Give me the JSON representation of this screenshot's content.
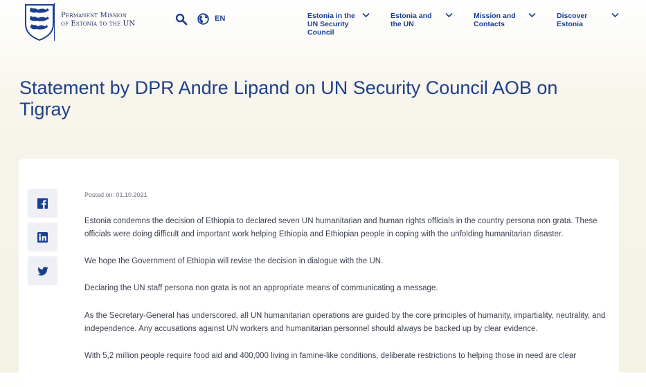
{
  "header": {
    "brand_line1": "Permanent Mission",
    "brand_line2": "of Estonia to the UN",
    "lang_label": "EN",
    "logo_icon": "estonian-coat-of-arms-icon",
    "search_icon": "search-icon",
    "globe_icon": "globe-icon",
    "nav": [
      {
        "label": "Estonia in the UN Security Council"
      },
      {
        "label": "Estonia and the UN"
      },
      {
        "label": "Mission and Contacts"
      },
      {
        "label": "Discover Estonia"
      }
    ]
  },
  "page": {
    "title": "Statement by DPR Andre Lipand on UN Security Council AOB on Tigray",
    "posted_on": "Posted on: 01.10.2021",
    "paragraphs": [
      "Estonia condemns the decision of Ethiopia to declared seven UN humanitarian and human rights officials in the country persona non grata. These officials were doing difficult and important work helping Ethiopia and Ethiopian people in coping with the unfolding humanitarian disaster.",
      "We hope the Government of Ethiopia will revise the decision in dialogue with the UN.",
      "Declaring the UN staff persona non grata is not an appropriate means of communicating a message.",
      "As the Secretary-General has underscored, all UN humanitarian operations are guided by the core principles of humanity, impartiality, neutrality, and independence. Any accusations against UN workers and humanitarian personnel should always be backed up by clear evidence.",
      "With 5,2 million people require food aid and 400,000 living in famine-like conditions, deliberate restrictions to helping those in need are clear"
    ]
  },
  "share": {
    "icons": [
      "facebook-icon",
      "linkedin-icon",
      "twitter-icon"
    ]
  },
  "colors": {
    "brand_blue": "#1b3f8f",
    "title_blue": "#1f3f8a",
    "background": "#f4f1e5",
    "share_bg": "#eef0f5"
  }
}
